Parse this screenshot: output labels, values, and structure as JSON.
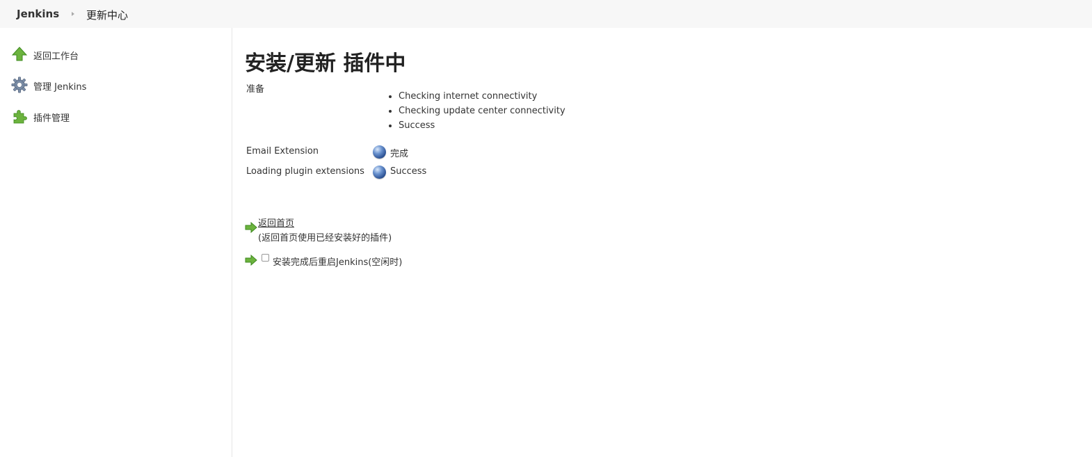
{
  "breadcrumb": {
    "home": "Jenkins",
    "current": "更新中心"
  },
  "sidebar": {
    "items": [
      {
        "label": "返回工作台",
        "icon": "up-arrow-icon"
      },
      {
        "label": "管理 Jenkins",
        "icon": "gear-icon"
      },
      {
        "label": "插件管理",
        "icon": "puzzle-icon"
      }
    ]
  },
  "main": {
    "title": "安装/更新 插件中",
    "prepare_label": "准备",
    "checks": [
      "Checking internet connectivity",
      "Checking update center connectivity",
      "Success"
    ],
    "jobs": [
      {
        "name": "Email Extension",
        "status": "完成",
        "status_icon": "blue-ball-icon"
      },
      {
        "name": "Loading plugin extensions",
        "status": "Success",
        "status_icon": "blue-ball-icon"
      }
    ],
    "home_link": "返回首页",
    "home_desc": "(返回首页使用已经安装好的插件)",
    "restart_label": "安装完成后重启Jenkins(空闲时)",
    "restart_checked": false
  },
  "colors": {
    "header_bg": "#f7f7f7",
    "icon_green": "#6cb33e",
    "ball_blue": "#2f5597"
  }
}
